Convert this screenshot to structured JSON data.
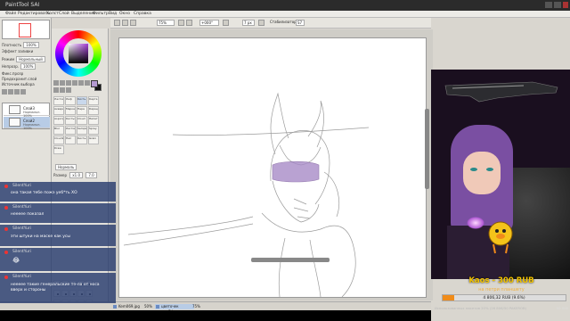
{
  "app": {
    "title": "PaintTool SAI",
    "menu": [
      "Файл",
      "Редактировать",
      "Холст",
      "Слой",
      "Выделение",
      "Фильтр",
      "Вид",
      "Окно",
      "Справка"
    ]
  },
  "toolbar": {
    "zoom": "75%",
    "angle": "+000°",
    "brush": "7 px",
    "stabilizer_label": "Стабилизатор",
    "stabilizer": "S7"
  },
  "left_panel": {
    "opacity_label": "Плотность",
    "opacity": "100%",
    "effect": "Эффект заливки",
    "mode_label": "Режим",
    "mode": "Нормальный",
    "layer_opacity_label": "Непрозр.",
    "layer_opacity": "100%",
    "checkboxes": [
      "Фикс.прозр",
      "Предохранит.слой",
      "Источник выбора"
    ],
    "layers": [
      {
        "name": "Слой3",
        "mode": "Нормальн. 100%"
      },
      {
        "name": "Слой2",
        "mode": "Нормальн. 100%"
      }
    ]
  },
  "tool_panel": {
    "brushes": [
      "Ластик",
      "Лиф",
      "Кисть",
      "Карта",
      "Акварель",
      "Маркер",
      "Пера",
      "Карандаш",
      "Аэрограф",
      "Кисть2",
      "Cloud",
      "Пипетка",
      "Blur",
      "Ластик2",
      "Sample",
      "Spray",
      "Cloud2",
      "Hair",
      "Кисть3",
      "Grain",
      "Draw"
    ],
    "selected_brush": "Карта",
    "normal_label": "Нормаль",
    "size_label": "Размер",
    "size": "7.0",
    "size_mult": "x1.0"
  },
  "chat": [
    {
      "user": "SilentYuri",
      "text": "она такая тебе пожэ уеб*ть ХО"
    },
    {
      "user": "SilentYuri",
      "text": "неееее показал"
    },
    {
      "user": "SilentYuri",
      "text": "эти штуки на маске как усы"
    },
    {
      "user": "SilentYuri",
      "text": ""
    },
    {
      "user": "SilentYuri",
      "text": "неееее такие генеральские те-ла от носа вверх и стороны"
    }
  ],
  "taskbar": {
    "tabs": [
      "Kem069.jpg",
      "50%",
      "цветочек мгоД.jpg",
      "75%"
    ]
  },
  "alert": {
    "text": "Kaos - 300 RUB"
  },
  "goal": {
    "title": "на петри планшету",
    "amount": "4 806,32 RUB (9.6%)",
    "progress": 0.096,
    "footer": "Использованных пакетов 20% (26 806/50 PAKEROB)",
    "target": "50 000"
  },
  "colors": {
    "foreground": "#b49ad0",
    "background": "#111111",
    "accent": "#f08c1a"
  }
}
